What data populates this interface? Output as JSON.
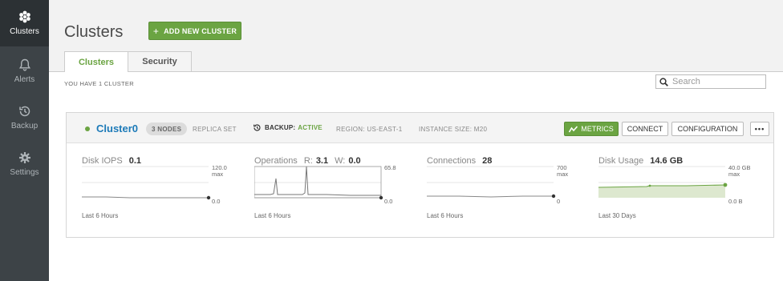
{
  "sidebar": {
    "items": [
      {
        "label": "Clusters",
        "icon": "clusters-icon",
        "active": true
      },
      {
        "label": "Alerts",
        "icon": "bell-icon"
      },
      {
        "label": "Backup",
        "icon": "history-icon"
      },
      {
        "label": "Settings",
        "icon": "gear-icon"
      }
    ]
  },
  "header": {
    "title": "Clusters",
    "add_button": "ADD NEW CLUSTER",
    "add_button_icon": "+"
  },
  "tabs": [
    {
      "label": "Clusters",
      "active": true
    },
    {
      "label": "Security"
    }
  ],
  "summary": "YOU HAVE 1 CLUSTER",
  "search": {
    "placeholder": "Search"
  },
  "cluster": {
    "name": "Cluster0",
    "nodes_badge": "3 NODES",
    "replica": "REPLICA SET",
    "backup_label": "BACKUP:",
    "backup_status": "ACTIVE",
    "region": "REGION: US-EAST-1",
    "instance": "INSTANCE SIZE: M20",
    "buttons": {
      "metrics": "METRICS",
      "connect": "CONNECT",
      "configuration": "CONFIGURATION",
      "more": "•••"
    },
    "status_color": "#6ba442"
  },
  "metrics": [
    {
      "title": "Disk IOPS",
      "value": "0.1",
      "max": "120.0",
      "max_unit": "max",
      "min": "0.0",
      "footer": "Last 6 Hours"
    },
    {
      "title": "Operations",
      "r_label": "R:",
      "r_value": "3.1",
      "w_label": "W:",
      "w_value": "0.0",
      "max": "65.8",
      "min": "0.0",
      "footer": "Last 6 Hours"
    },
    {
      "title": "Connections",
      "value": "28",
      "max": "700",
      "max_unit": "max",
      "min": "0",
      "footer": "Last 6 Hours"
    },
    {
      "title": "Disk Usage",
      "value": "14.6 GB",
      "max": "40.0 GB",
      "max_unit": "max",
      "min": "0.0 B",
      "footer": "Last 30 Days"
    }
  ],
  "colors": {
    "accent": "#6ba442",
    "link": "#1c7ab8",
    "sidebar": "#3d4347"
  }
}
